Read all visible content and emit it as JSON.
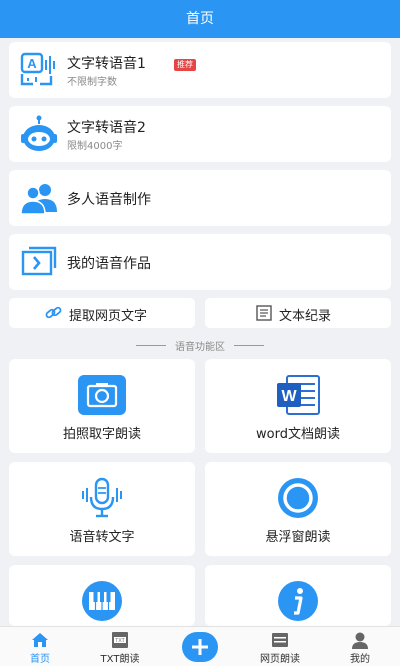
{
  "header": {
    "title": "首页"
  },
  "menu_cards": [
    {
      "title": "文字转语音1",
      "subtitle": "不限制字数",
      "badge": "推荐",
      "icon": "text-to-speech-icon"
    },
    {
      "title": "文字转语音2",
      "subtitle": "限制4000字",
      "icon": "robot-icon"
    },
    {
      "title": "多人语音制作",
      "icon": "people-icon"
    },
    {
      "title": "我的语音作品",
      "icon": "my-works-icon"
    }
  ],
  "quick_actions": [
    {
      "label": "提取网页文字",
      "icon": "link-icon"
    },
    {
      "label": "文本纪录",
      "icon": "document-icon"
    }
  ],
  "section": {
    "label": "语音功能区"
  },
  "features": [
    {
      "label": "拍照取字朗读",
      "icon": "camera-icon"
    },
    {
      "label": "word文档朗读",
      "icon": "word-icon"
    },
    {
      "label": "语音转文字",
      "icon": "microphone-icon"
    },
    {
      "label": "悬浮窗朗读",
      "icon": "floating-window-icon"
    },
    {
      "label": "",
      "icon": "piano-icon"
    },
    {
      "label": "",
      "icon": "info-icon"
    }
  ],
  "tabbar": {
    "items": [
      {
        "label": "首页",
        "icon": "home-icon",
        "active": true
      },
      {
        "label": "TXT朗读",
        "icon": "txt-file-icon"
      },
      {
        "label": "",
        "icon": "plus-icon"
      },
      {
        "label": "网页朗读",
        "icon": "web-icon"
      },
      {
        "label": "我的",
        "icon": "user-icon"
      }
    ]
  },
  "colors": {
    "brand": "#2b95f3",
    "badge": "#e54545",
    "background": "#f0f1f5"
  }
}
